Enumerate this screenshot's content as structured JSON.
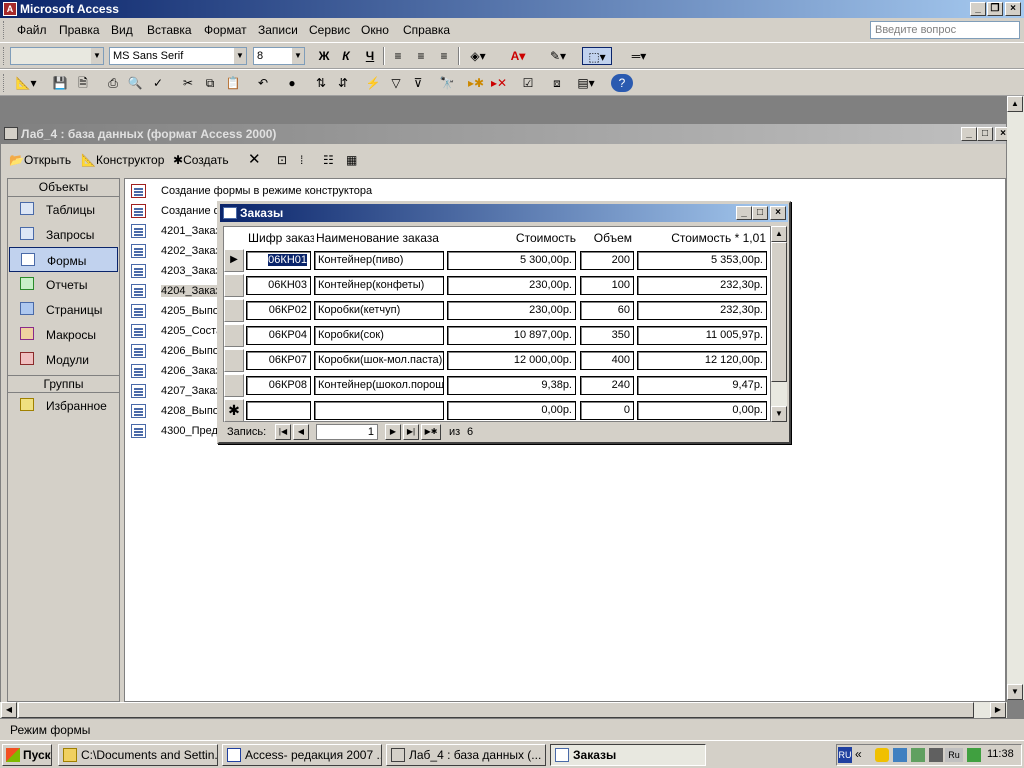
{
  "app": {
    "title": "Microsoft Access"
  },
  "menu": {
    "items": [
      "Файл",
      "Правка",
      "Вид",
      "Вставка",
      "Формат",
      "Записи",
      "Сервис",
      "Окно",
      "Справка"
    ],
    "ask_placeholder": "Введите вопрос"
  },
  "format_toolbar": {
    "object_combo": "",
    "font": "MS Sans Serif",
    "size": "8",
    "bold": "Ж",
    "italic": "К",
    "underline": "Ч"
  },
  "db_window": {
    "title": "Лаб_4 : база данных (формат Access 2000)",
    "toolbar": {
      "open": "Открыть",
      "design": "Конструктор",
      "create": "Создать"
    },
    "objects_header": "Объекты",
    "objects": [
      "Таблицы",
      "Запросы",
      "Формы",
      "Отчеты",
      "Страницы",
      "Макросы",
      "Модули"
    ],
    "groups_header": "Группы",
    "groups": [
      "Избранное"
    ],
    "list": [
      "Создание формы в режиме конструктора",
      "Создание ф",
      "4201_Заказ",
      "4202_Заказ",
      "4203_Заказ",
      "4204_Заказ",
      "4205_Выпо",
      "4205_Соста",
      "4206_Выпо",
      "4206_Заказ",
      "4207_Заказ",
      "4208_Выпо",
      "4300_Пред"
    ]
  },
  "form": {
    "title": "Заказы",
    "headers": [
      "Шифр заказ",
      "Наименование заказа",
      "Стоимость",
      "Объем",
      "Стоимость * 1,01"
    ],
    "rows": [
      [
        "06КН01",
        "Контейнер(пиво)",
        "5 300,00р.",
        "200",
        "5 353,00р."
      ],
      [
        "06КН03",
        "Контейнер(конфеты)",
        "230,00р.",
        "100",
        "232,30р."
      ],
      [
        "06КР02",
        "Коробки(кетчуп)",
        "230,00р.",
        "60",
        "232,30р."
      ],
      [
        "06КР04",
        "Коробки(сок)",
        "10 897,00р.",
        "350",
        "11 005,97р."
      ],
      [
        "06КР07",
        "Коробки(шок-мол.паста)",
        "12 000,00р.",
        "400",
        "12 120,00р."
      ],
      [
        "06КР08",
        "Контейнер(шокол.порош",
        "9,38р.",
        "240",
        "9,47р."
      ]
    ],
    "new_row": [
      "",
      "",
      "0,00р.",
      "0",
      "0,00р."
    ],
    "nav": {
      "label": "Запись:",
      "current": "1",
      "of": "из",
      "total": "6"
    }
  },
  "status": {
    "text": "Режим формы"
  },
  "taskbar": {
    "start": "Пуск",
    "items": [
      "C:\\Documents and Settin...",
      "Access- редакция 2007 ...",
      "Лаб_4 : база данных (...",
      "Заказы"
    ],
    "lang": "RU",
    "clock": "11:38"
  }
}
